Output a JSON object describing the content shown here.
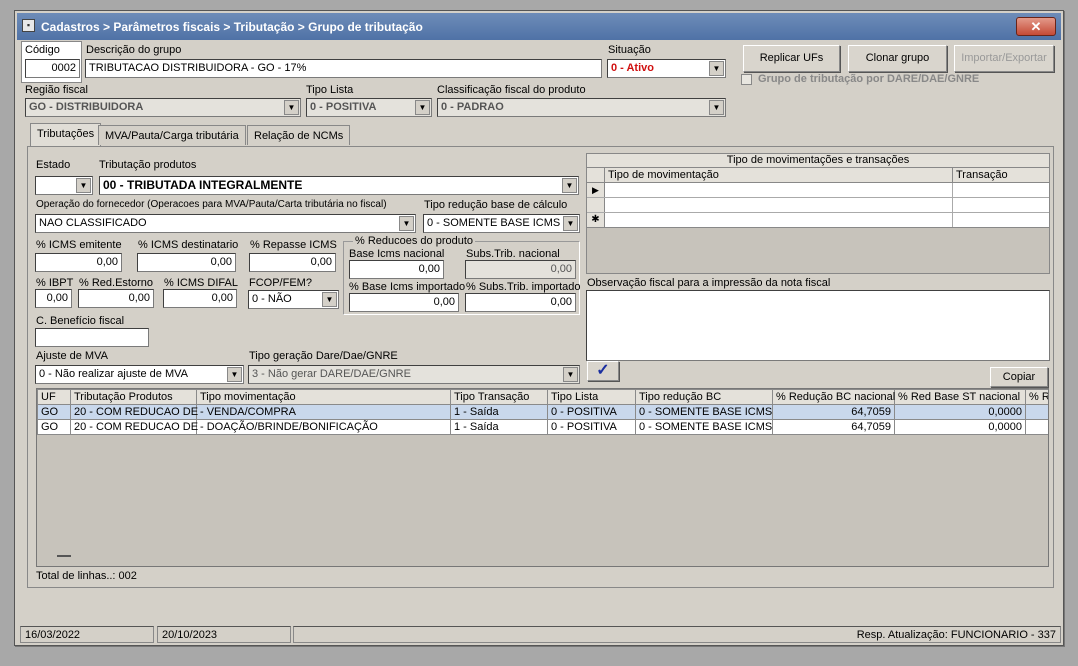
{
  "window": {
    "title": "Cadastros > Parâmetros fiscais > Tributação > Grupo de tributação",
    "close": "✕"
  },
  "header": {
    "codigo_label": "Código",
    "codigo": "0002",
    "descricao_label": "Descrição do grupo",
    "descricao": "TRIBUTACAO DISTRIBUIDORA - GO - 17%",
    "situacao_label": "Situação",
    "situacao": "0 - Ativo",
    "replicar": "Replicar UFs",
    "clonar": "Clonar grupo",
    "importar": "Importar/Exportar",
    "dare_label": "Grupo de tributação por DARE/DAE/GNRE",
    "regiao_label": "Região fiscal",
    "regiao": "GO - DISTRIBUIDORA",
    "tipo_lista_label": "Tipo Lista",
    "tipo_lista": "0 - POSITIVA",
    "classif_label": "Classificação fiscal do produto",
    "classif": "0 - PADRAO"
  },
  "tabs": [
    "Tributações",
    "MVA/Pauta/Carga tributária",
    "Relação de NCMs"
  ],
  "form": {
    "estado_label": "Estado",
    "estado": "",
    "trib_label": "Tributação produtos",
    "trib": "00 - TRIBUTADA INTEGRALMENTE",
    "oper_label": "Operação do fornecedor (Operacoes para MVA/Pauta/Carta tributária no fiscal)",
    "oper": "NAO CLASSIFICADO",
    "red_base_label": "Tipo redução base de cálculo",
    "red_base": "0 - SOMENTE BASE ICMS",
    "icms_emit_label": "% ICMS emitente",
    "icms_emit": "0,00",
    "icms_dest_label": "% ICMS destinatario",
    "icms_dest": "0,00",
    "repasse_label": "% Repasse ICMS",
    "repasse": "0,00",
    "reducoes_label": "% Reducoes do produto",
    "base_nac_label": "Base Icms nacional",
    "base_nac": "0,00",
    "subs_nac_label": "Subs.Trib. nacional",
    "subs_nac": "0,00",
    "ibpt_label": "% IBPT",
    "ibpt": "0,00",
    "red_estorno_label": "% Red.Estorno",
    "red_estorno": "0,00",
    "icms_difal_label": "% ICMS DIFAL",
    "icms_difal": "0,00",
    "fcop_label": "FCOP/FEM?",
    "fcop": "0 - NÃO",
    "base_imp_label": "% Base Icms importado",
    "base_imp": "0,00",
    "subs_imp_label": "% Subs.Trib. importado",
    "subs_imp": "0,00",
    "beneficio_label": "C. Benefício fiscal",
    "beneficio": "",
    "ajuste_label": "Ajuste de MVA",
    "ajuste": "0 - Não realizar ajuste de MVA",
    "dare_tipo_label": "Tipo geração Dare/Dae/GNRE",
    "dare_tipo": "3 - Não gerar DARE/DAE/GNRE",
    "check": "✓",
    "copiar": "Copiar"
  },
  "mov": {
    "title": "Tipo de movimentações e transações",
    "col1": "Tipo de movimentação",
    "col2": "Transação",
    "obs_label": "Observação fiscal para a impressão da nota fiscal"
  },
  "table": {
    "headers": [
      "UF",
      "Tributação Produtos",
      "Tipo movimentação",
      "Tipo Transação",
      "Tipo Lista",
      "Tipo redução BC",
      "% Redução BC nacional",
      "% Red Base ST nacional",
      "% Re"
    ],
    "rows": [
      [
        "GO",
        "20 - COM REDUCAO DE",
        "- VENDA/COMPRA",
        "1 - Saída",
        "0 - POSITIVA",
        "0 - SOMENTE BASE ICMS",
        "64,7059",
        "0,0000",
        ""
      ],
      [
        "GO",
        "20 - COM REDUCAO DE",
        "- DOAÇÃO/BRINDE/BONIFICAÇÃO",
        "1 - Saída",
        "0 - POSITIVA",
        "0 - SOMENTE BASE ICMS",
        "64,7059",
        "0,0000",
        ""
      ]
    ],
    "total": "Total de linhas..: 002"
  },
  "status": {
    "d1": "16/03/2022",
    "d2": "20/10/2023",
    "resp": "Resp. Atualização: FUNCIONARIO - 337"
  }
}
